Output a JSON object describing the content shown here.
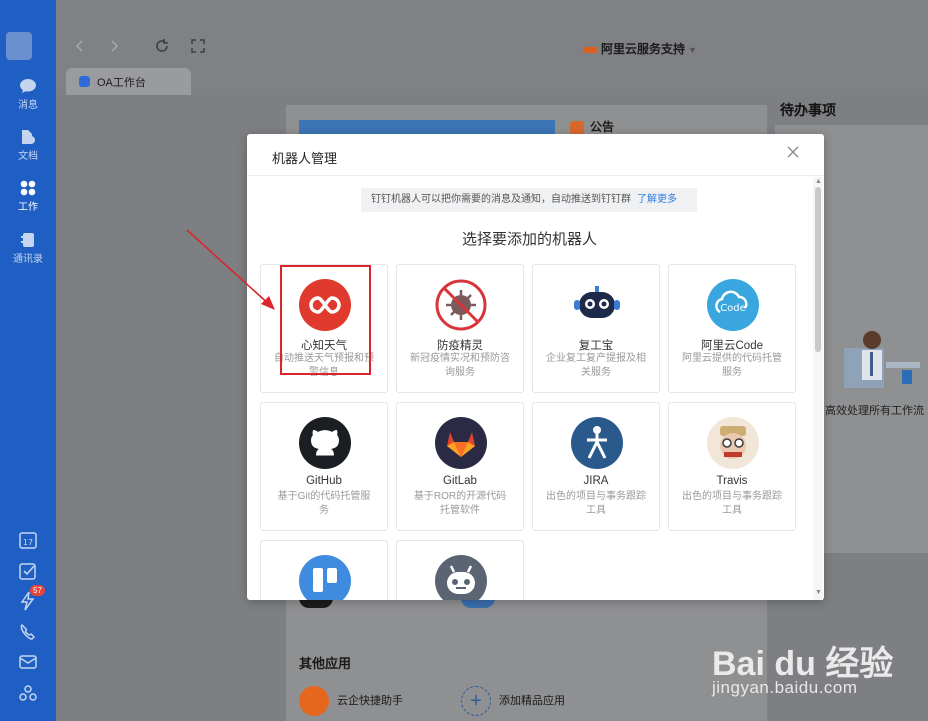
{
  "sidebar": {
    "items": [
      {
        "label": "消息",
        "icon": "message-icon"
      },
      {
        "label": "文档",
        "icon": "document-icon"
      },
      {
        "label": "工作",
        "icon": "work-grid-icon",
        "active": true
      },
      {
        "label": "通讯录",
        "icon": "contacts-icon"
      }
    ],
    "bottom_icons": [
      "calendar-icon",
      "todo-check-icon",
      "ding-icon",
      "phone-icon",
      "mail-icon",
      "more-apps-icon"
    ],
    "calendar_day": "17",
    "ding_badge": "57"
  },
  "topbar": {
    "tab_label": "OA工作台",
    "org_name": "阿里云服务支持"
  },
  "background": {
    "notice_label": "公告",
    "todo_title": "待办事项",
    "todo_desc": "高效处理所有工作流",
    "other_apps_title": "其他应用",
    "other_apps": [
      "云企快捷助手",
      "添加精品应用"
    ]
  },
  "modal": {
    "title": "机器人管理",
    "tip_text": "钉钉机器人可以把你需要的消息及通知，自动推送到钉钉群",
    "tip_link": "了解更多",
    "section_title": "选择要添加的机器人",
    "robots": [
      {
        "name": "心知天气",
        "desc": "自动推送天气预报和预警信息",
        "color": "#e03a2f",
        "icon": "xinzhi-weather-icon"
      },
      {
        "name": "防疫精灵",
        "desc": "新冠疫情实况和预防咨询服务",
        "color": "#ffffff",
        "icon": "epidemic-virus-icon"
      },
      {
        "name": "复工宝",
        "desc": "企业复工复产提报及相关服务",
        "color": "#ffffff",
        "icon": "robot-face-icon"
      },
      {
        "name": "阿里云Code",
        "desc": "阿里云提供的代码托管服务",
        "color": "#3aa6e0",
        "icon": "aliyun-code-icon"
      },
      {
        "name": "GitHub",
        "desc": "基于Git的代码托管服务",
        "color": "#1b1f23",
        "icon": "github-icon"
      },
      {
        "name": "GitLab",
        "desc": "基于ROR的开源代码托管软件",
        "color": "#2a2a44",
        "icon": "gitlab-icon"
      },
      {
        "name": "JIRA",
        "desc": "出色的项目与事务跟踪工具",
        "color": "#2a5a8c",
        "icon": "jira-icon"
      },
      {
        "name": "Travis",
        "desc": "出色的项目与事务跟踪工具",
        "color": "#f1e6d8",
        "icon": "travis-icon"
      },
      {
        "name": "",
        "desc": "",
        "color": "#3e8be0",
        "icon": "trello-icon"
      },
      {
        "name": "",
        "desc": "",
        "color": "#5a6472",
        "icon": "custom-robot-icon"
      }
    ]
  },
  "watermark": {
    "brand": "Bai du 经验",
    "url": "jingyan.baidu.com"
  }
}
